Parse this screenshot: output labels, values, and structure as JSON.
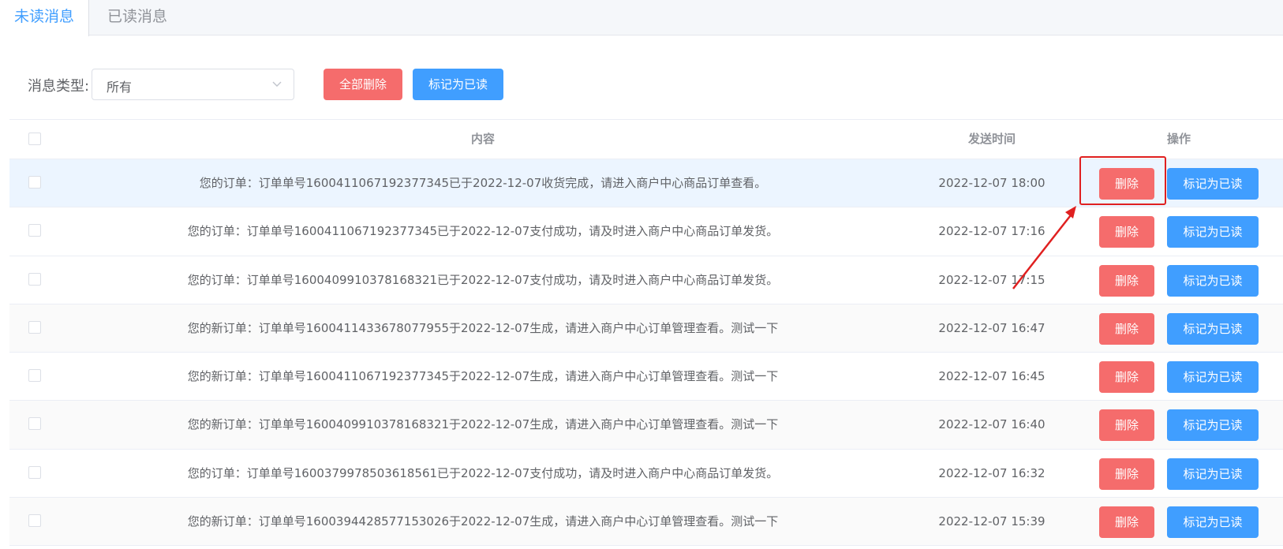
{
  "tabs": [
    {
      "label": "未读消息",
      "active": true
    },
    {
      "label": "已读消息",
      "active": false
    }
  ],
  "filter": {
    "label": "消息类型:",
    "selected": "所有"
  },
  "toolbar": {
    "delete_all_label": "全部删除",
    "mark_all_read_label": "标记为已读"
  },
  "table": {
    "headers": {
      "content": "内容",
      "time": "发送时间",
      "ops": "操作"
    },
    "row_delete_label": "删除",
    "row_mark_label": "标记为已读",
    "rows": [
      {
        "content": "您的订单：订单单号1600411067192377345已于2022-12-07收货完成，请进入商户中心商品订单查看。",
        "time": "2022-12-07 18:00"
      },
      {
        "content": "您的订单：订单单号1600411067192377345已于2022-12-07支付成功，请及时进入商户中心商品订单发货。",
        "time": "2022-12-07 17:16"
      },
      {
        "content": "您的订单：订单单号1600409910378168321已于2022-12-07支付成功，请及时进入商户中心商品订单发货。",
        "time": "2022-12-07 17:15"
      },
      {
        "content": "您的新订单：订单单号1600411433678077955于2022-12-07生成，请进入商户中心订单管理查看。测试一下",
        "time": "2022-12-07 16:47"
      },
      {
        "content": "您的新订单：订单单号1600411067192377345于2022-12-07生成，请进入商户中心订单管理查看。测试一下",
        "time": "2022-12-07 16:45"
      },
      {
        "content": "您的新订单：订单单号1600409910378168321于2022-12-07生成，请进入商户中心订单管理查看。测试一下",
        "time": "2022-12-07 16:40"
      },
      {
        "content": "您的订单：订单单号1600379978503618561已于2022-12-07支付成功，请及时进入商户中心商品订单发货。",
        "time": "2022-12-07 16:32"
      },
      {
        "content": "您的新订单：订单单号1600394428577153026于2022-12-07生成，请进入商户中心订单管理查看。测试一下",
        "time": "2022-12-07 15:39"
      }
    ]
  },
  "colors": {
    "primary": "#409eff",
    "danger": "#f56c6c",
    "annotation": "#e02020"
  }
}
